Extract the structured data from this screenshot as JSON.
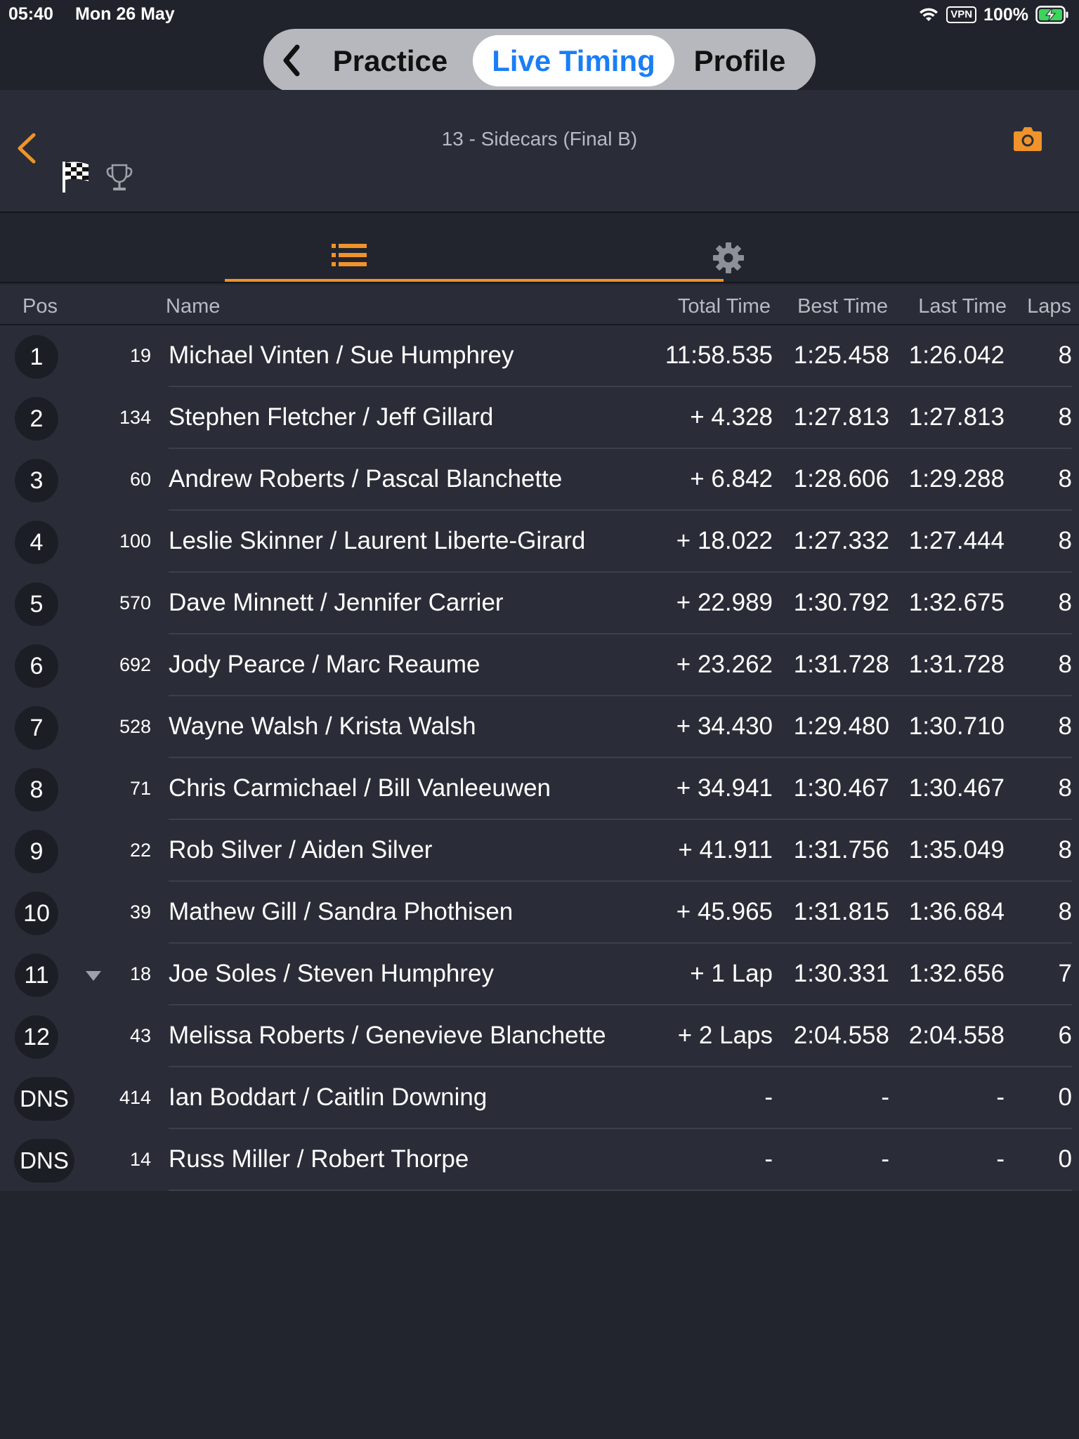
{
  "status_bar": {
    "time": "05:40",
    "date": "Mon 26 May",
    "vpn": "VPN",
    "battery": "100%"
  },
  "nav": {
    "practice": "Practice",
    "live_timing": "Live Timing",
    "profile": "Profile"
  },
  "header": {
    "title": "13 - Sidecars (Final B)"
  },
  "columns": {
    "pos": "Pos",
    "name": "Name",
    "total": "Total Time",
    "best": "Best Time",
    "last": "Last Time",
    "laps": "Laps"
  },
  "colors": {
    "accent": "#f0932a",
    "active_blue": "#1a7ef5",
    "background": "#22252e",
    "row": "#2a2d37"
  },
  "rows": [
    {
      "pos": "1",
      "kart": "19",
      "name": "Michael Vinten /  Sue Humphrey",
      "total": "11:58.535",
      "best": "1:25.458",
      "last": "1:26.042",
      "laps": "8"
    },
    {
      "pos": "2",
      "kart": "134",
      "name": "Stephen Fletcher /  Jeff Gillard",
      "total": "+ 4.328",
      "best": "1:27.813",
      "last": "1:27.813",
      "laps": "8"
    },
    {
      "pos": "3",
      "kart": "60",
      "name": "Andrew Roberts /  Pascal Blanchette",
      "total": "+ 6.842",
      "best": "1:28.606",
      "last": "1:29.288",
      "laps": "8"
    },
    {
      "pos": "4",
      "kart": "100",
      "name": "Leslie Skinner /  Laurent Liberte-Girard",
      "total": "+ 18.022",
      "best": "1:27.332",
      "last": "1:27.444",
      "laps": "8"
    },
    {
      "pos": "5",
      "kart": "570",
      "name": "Dave Minnett /  Jennifer Carrier",
      "total": "+ 22.989",
      "best": "1:30.792",
      "last": "1:32.675",
      "laps": "8"
    },
    {
      "pos": "6",
      "kart": "692",
      "name": "Jody Pearce /  Marc Reaume",
      "total": "+ 23.262",
      "best": "1:31.728",
      "last": "1:31.728",
      "laps": "8"
    },
    {
      "pos": "7",
      "kart": "528",
      "name": "Wayne Walsh /  Krista Walsh",
      "total": "+ 34.430",
      "best": "1:29.480",
      "last": "1:30.710",
      "laps": "8"
    },
    {
      "pos": "8",
      "kart": "71",
      "name": "Chris Carmichael /  Bill Vanleeuwen",
      "total": "+ 34.941",
      "best": "1:30.467",
      "last": "1:30.467",
      "laps": "8"
    },
    {
      "pos": "9",
      "kart": "22",
      "name": "Rob Silver /  Aiden Silver",
      "total": "+ 41.911",
      "best": "1:31.756",
      "last": "1:35.049",
      "laps": "8"
    },
    {
      "pos": "10",
      "kart": "39",
      "name": "Mathew Gill /  Sandra Phothisen",
      "total": "+ 45.965",
      "best": "1:31.815",
      "last": "1:36.684",
      "laps": "8"
    },
    {
      "pos": "11",
      "kart": "18",
      "name": "Joe Soles /  Steven Humphrey",
      "total": "+ 1 Lap",
      "best": "1:30.331",
      "last": "1:32.656",
      "laps": "7",
      "indicator": "down"
    },
    {
      "pos": "12",
      "kart": "43",
      "name": "Melissa Roberts /  Genevieve Blanchette",
      "total": "+ 2 Laps",
      "best": "2:04.558",
      "last": "2:04.558",
      "laps": "6"
    },
    {
      "pos": "DNS",
      "kart": "414",
      "name": "Ian Boddart /  Caitlin Downing",
      "total": "-",
      "best": "-",
      "last": "-",
      "laps": "0"
    },
    {
      "pos": "DNS",
      "kart": "14",
      "name": "Russ Miller /  Robert Thorpe",
      "total": "-",
      "best": "-",
      "last": "-",
      "laps": "0"
    }
  ]
}
